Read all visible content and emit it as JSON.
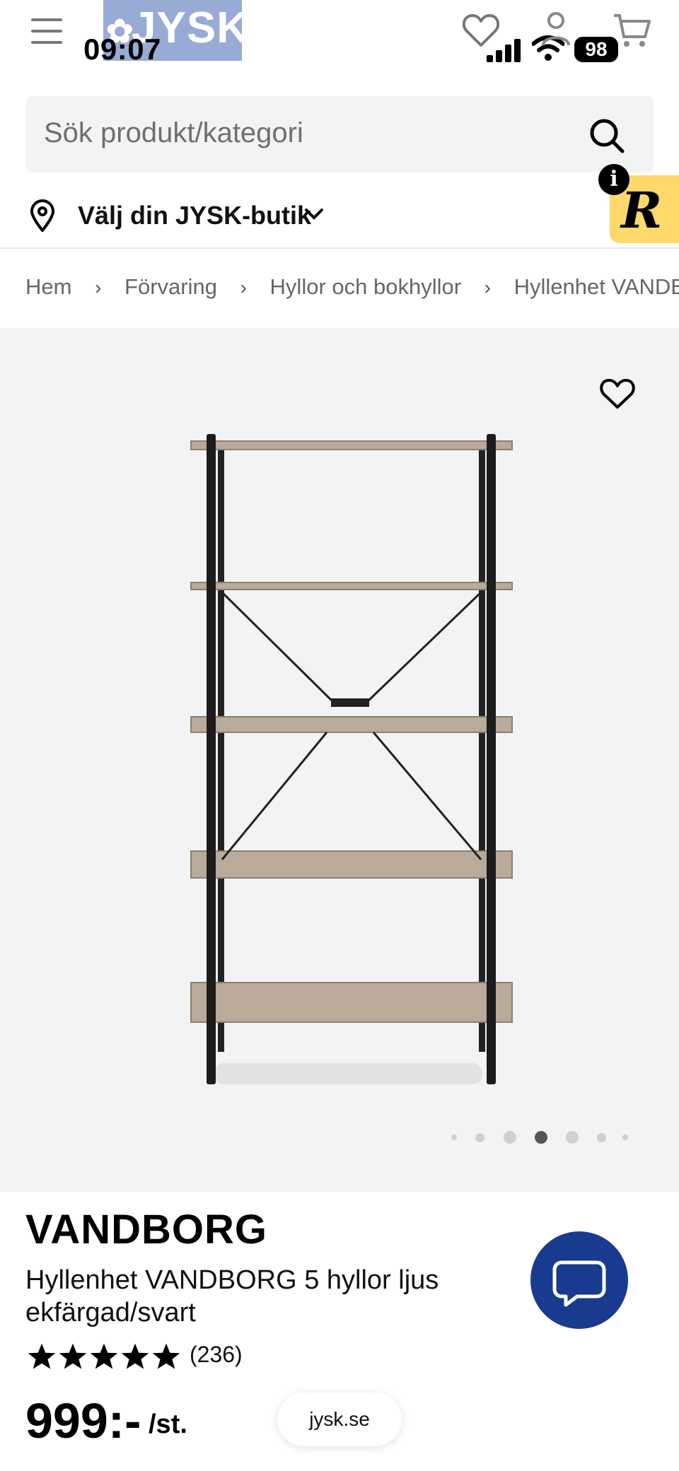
{
  "status_bar": {
    "time": "09:07",
    "battery": "98"
  },
  "header": {
    "logo_text": "JYSK"
  },
  "search": {
    "placeholder": "Sök produkt/kategori"
  },
  "store": {
    "label": "Välj din JYSK-butik"
  },
  "badge": {
    "info": "i",
    "letter": "R"
  },
  "breadcrumb": [
    "Hem",
    "Förvaring",
    "Hyllor och bokhyllor",
    "Hyllenhet VANDBO"
  ],
  "gallery": {
    "image_count": 7,
    "active_index": 3
  },
  "product": {
    "brand": "VANDBORG",
    "name": "Hyllenhet VANDBORG 5 hyllor ljus ekfärgad/svart",
    "rating_stars": 5,
    "rating_count": "(236)",
    "price": "999:-",
    "unit": "/st."
  },
  "browser": {
    "url": "jysk.se"
  },
  "colors": {
    "brand_blue": "#183b8f",
    "logo_bg": "#98abd5",
    "badge_yellow": "#ffd86b",
    "gallery_bg": "#f3f3f3"
  },
  "icons": [
    "menu-icon",
    "heart-icon",
    "account-icon",
    "cart-icon",
    "search-icon",
    "location-pin-icon",
    "chevron-down-icon",
    "chevron-right-icon",
    "chat-icon",
    "star-icon"
  ]
}
